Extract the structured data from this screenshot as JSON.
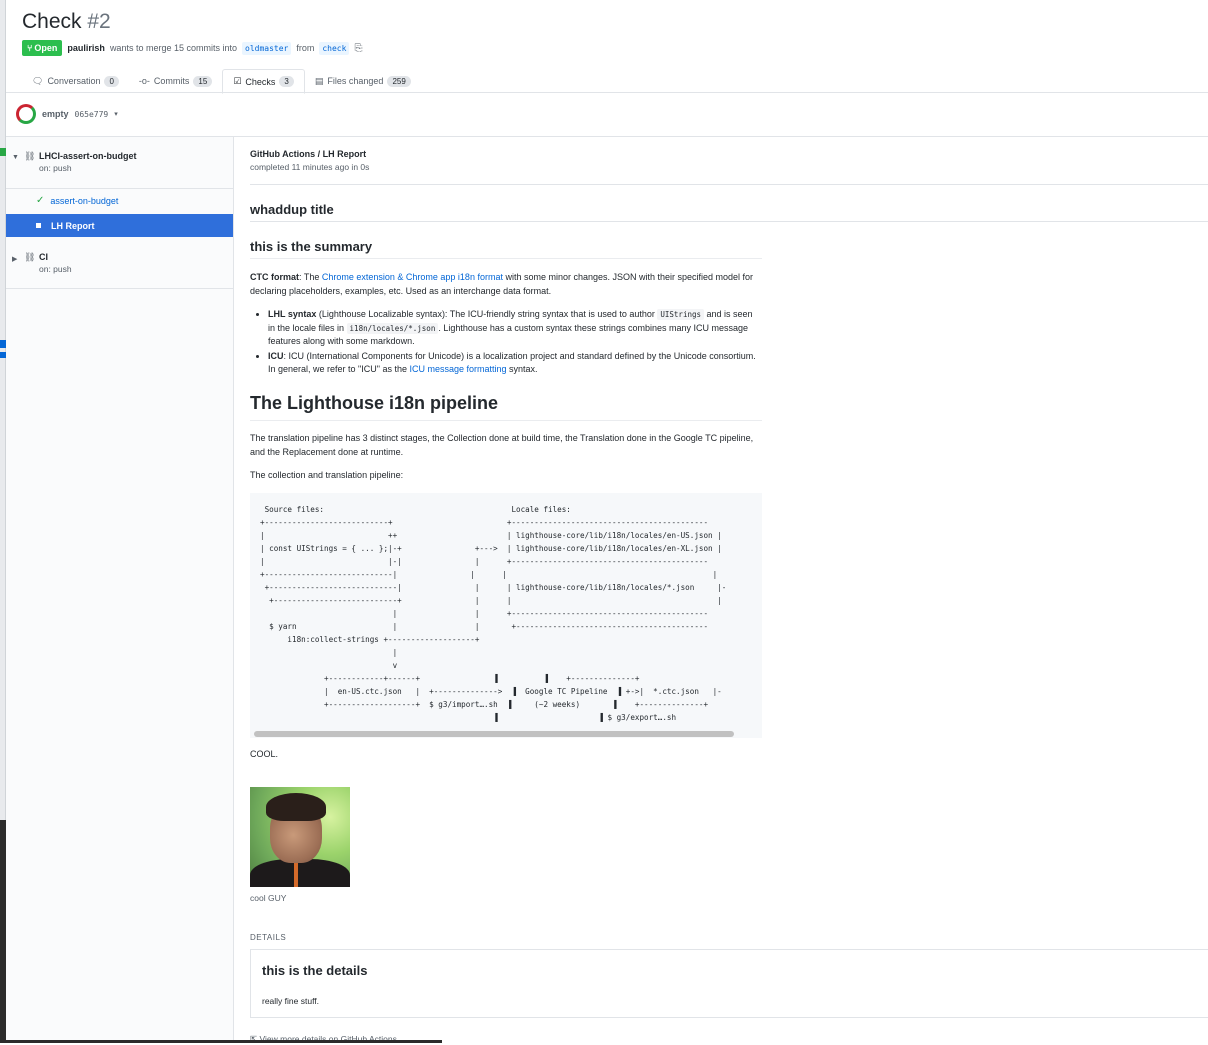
{
  "pr": {
    "title": "Check",
    "number": "#2",
    "state": "Open",
    "author": "paulirish",
    "merge_text": "wants to merge 15 commits into",
    "base_branch": "oldmaster",
    "from_text": "from",
    "head_branch": "check"
  },
  "tabs": [
    {
      "label": "Conversation",
      "count": "0"
    },
    {
      "label": "Commits",
      "count": "15"
    },
    {
      "label": "Checks",
      "count": "3",
      "active": true
    },
    {
      "label": "Files changed",
      "count": "259"
    }
  ],
  "commit": {
    "name": "empty",
    "sha": "065e779"
  },
  "sidebar": {
    "suites": [
      {
        "name": "LHCI-assert-on-budget",
        "trigger": "on: push",
        "runs": [
          {
            "label": "assert-on-budget",
            "status": "success"
          },
          {
            "label": "LH Report",
            "status": "selected"
          }
        ]
      },
      {
        "name": "CI",
        "trigger": "on: push"
      }
    ]
  },
  "run": {
    "title": "GitHub Actions / LH Report",
    "subtitle": "completed 11 minutes ago in 0s",
    "heading": "whaddup title",
    "summary_heading": "this is the summary",
    "ctc": {
      "label": "CTC format",
      "pre": ": The ",
      "link": "Chrome extension & Chrome app i18n format",
      "post": " with some minor changes. JSON with their specified model for declaring placeholders, examples, etc. Used as an interchange data format."
    },
    "bullets": {
      "lhl_label": "LHL syntax",
      "lhl_pre": " (Lighthouse Localizable syntax): The ICU-friendly string syntax that is used to author ",
      "lhl_code1": "UIStrings",
      "lhl_mid": " and is seen in the locale files in ",
      "lhl_code2": "i18n/locales/*.json",
      "lhl_post": ". Lighthouse has a custom syntax these strings combines many ICU message features along with some markdown.",
      "icu_label": "ICU",
      "icu_pre": ": ICU (International Components for Unicode) is a localization project and standard defined by the Unicode consortium. In general, we refer to \"ICU\" as the ",
      "icu_link": "ICU message formatting",
      "icu_post": " syntax."
    },
    "pipeline_heading": "The Lighthouse i18n pipeline",
    "pipeline_p1": "The translation pipeline has 3 distinct stages, the Collection done at build time, the Translation done in the Google TC pipeline, and the Replacement done at runtime.",
    "pipeline_p2": "The collection and translation pipeline:",
    "diagram": " Source files:                                         Locale files:\n+---------------------------+                         +-------------------------------------------\n|                           ++                        | lighthouse-core/lib/i18n/locales/en-US.json |\n| const UIStrings = { ... };|-+                +--->  | lighthouse-core/lib/i18n/locales/en-XL.json |\n|                           |-|                |      +-------------------------------------------\n+----------------------------|                |      |                                             |\n +----------------------------|                |      | lighthouse-core/lib/i18n/locales/*.json     |-\n  +---------------------------+                |      |                                             |\n                             |                 |      +-------------------------------------------\n  $ yarn                     |                 |       +------------------------------------------\n      i18n:collect-strings +-------------------+\n                             |\n                             v\n              +------------+------+                ▐          ▐    +--------------+\n              |  en-US.ctc.json   |  +-------------->  ▐  Google TC Pipeline  ▐ +->|  *.ctc.json   |-\n              +-------------------+  $ g3/import….sh  ▐     (~2 weeks)       ▐    +--------------+\n                                                   ▐                      ▐ $ g3/export….sh",
    "cool_text": "COOL.",
    "image_caption": "cool GUY",
    "details_label": "DETAILS",
    "details_title": "this is the details",
    "details_text": "really fine stuff.",
    "view_more": "View more details on GitHub Actions"
  }
}
